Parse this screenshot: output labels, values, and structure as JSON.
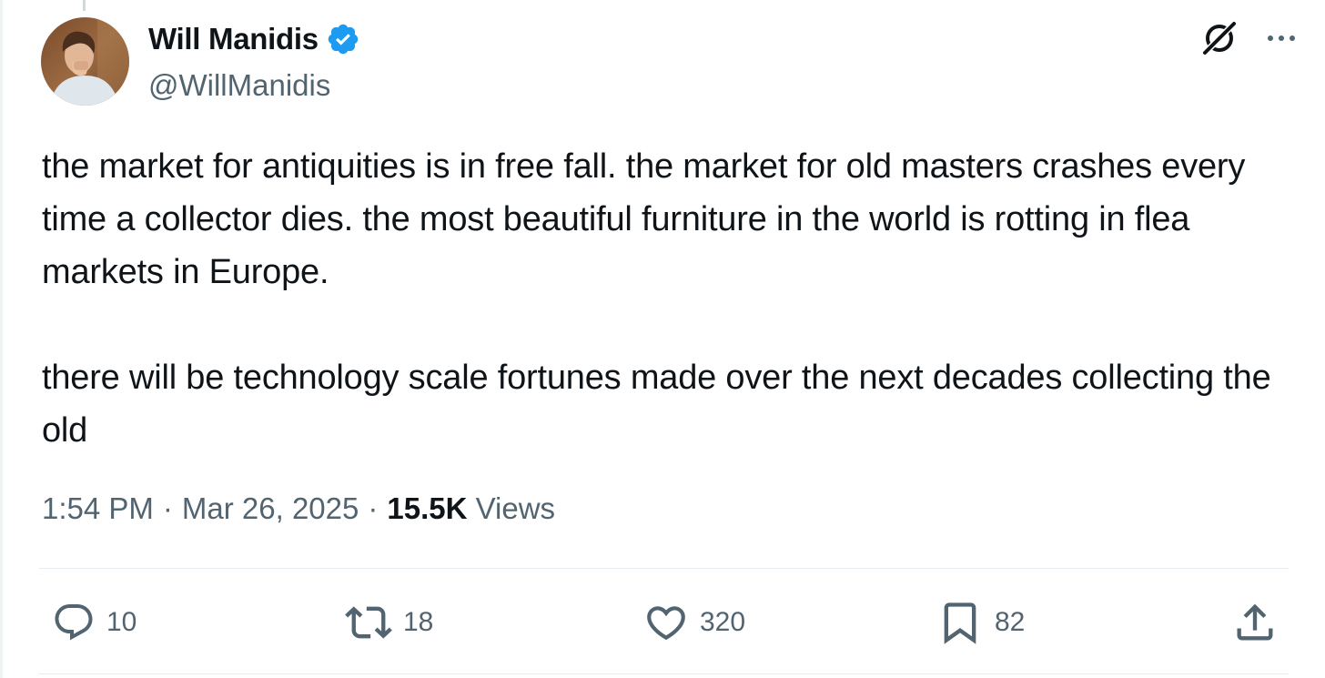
{
  "author": {
    "display_name": "Will Manidis",
    "handle": "@WillManidis",
    "verified": true,
    "avatar_icon": "avatar-photo"
  },
  "post": {
    "text": "the market for antiquities is in free fall. the market for old masters crashes every time a collector dies. the most beautiful furniture in the world is rotting in flea markets in Europe.\n\nthere will be technology scale fortunes made over the next decades collecting the old"
  },
  "meta": {
    "time": "1:54 PM",
    "separator": "·",
    "date": "Mar 26, 2025",
    "views_count": "15.5K",
    "views_label": "Views"
  },
  "actions": {
    "replies": "10",
    "reposts": "18",
    "likes": "320",
    "bookmarks": "82"
  },
  "colors": {
    "text": "#0f1419",
    "secondary": "#536471",
    "verified": "#1d9bf0",
    "divider": "#e6ecf0"
  }
}
